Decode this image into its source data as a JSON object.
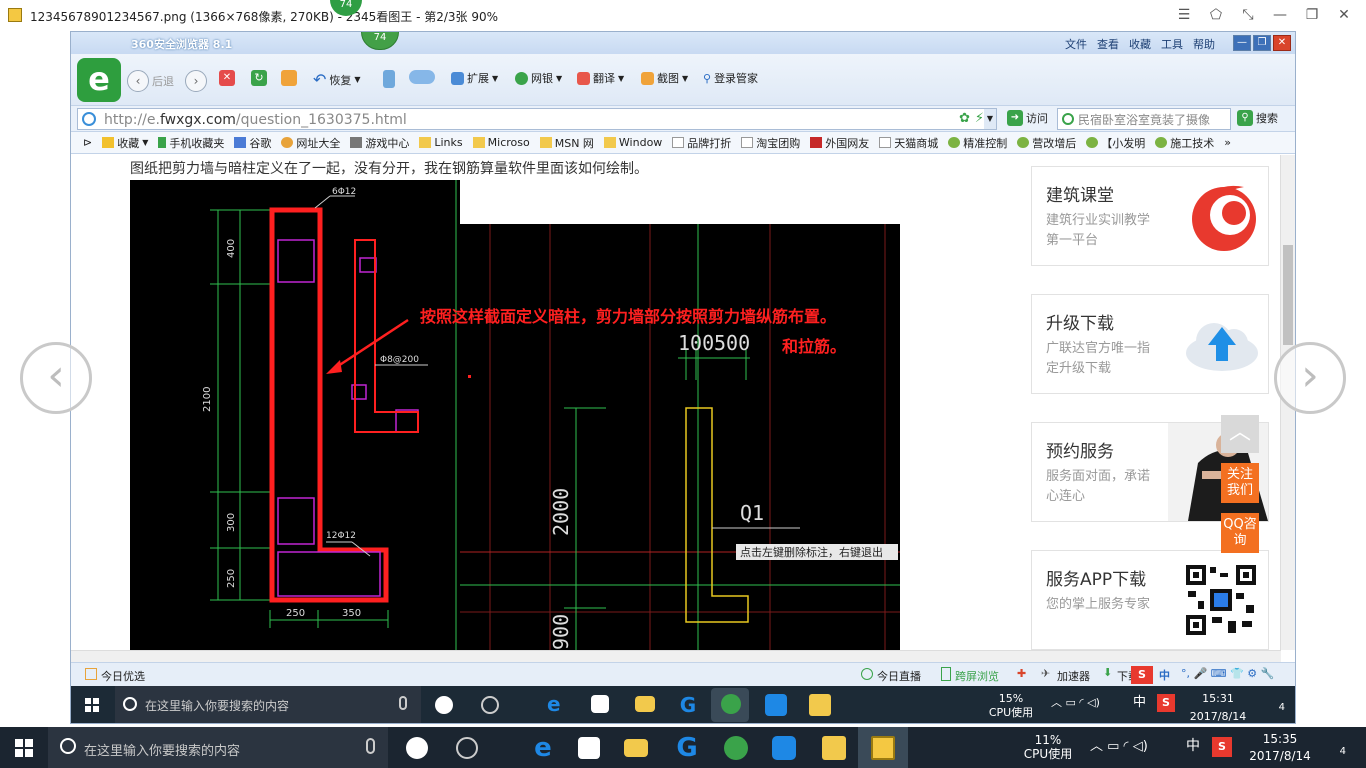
{
  "viewer": {
    "title": "12345678901234567.png (1366×768像素, 270KB) - 2345看图王 - 第2/3张 90%",
    "badge": "74",
    "controls": [
      "☰",
      "⬠",
      "⤡",
      "—",
      "❐",
      "✕"
    ],
    "prev_glyph": "‹",
    "next_glyph": "›"
  },
  "browser": {
    "title": "360安全浏览器 8.1",
    "badge": "74",
    "menu": [
      "文件",
      "查看",
      "收藏",
      "工具",
      "帮助"
    ],
    "toolbar": {
      "back": "后退",
      "restore": "恢复",
      "extend": "扩展",
      "bank": "网银",
      "translate": "翻译",
      "screenshot": "截图",
      "login": "登录管家"
    },
    "address": {
      "url_prefix": "http://e.",
      "url_domain": "fwxgx.com",
      "url_path": "/question_1630375.html",
      "visit": "访问",
      "search_value": "民宿卧室浴室竟装了摄像",
      "search_btn": "搜索"
    },
    "favorites": [
      "收藏",
      "手机收藏夹",
      "谷歌",
      "网址大全",
      "游戏中心",
      "Links",
      "Microso",
      "MSN 网",
      "Window",
      "品牌打折",
      "淘宝团购",
      "外国网友",
      "天猫商城",
      "精准控制",
      "营改增后",
      "【小发明",
      "施工技术"
    ],
    "status": {
      "left": "今日优选",
      "live": "今日直播",
      "cross": "跨屏浏览",
      "accel": "加速器",
      "download": "下载"
    },
    "inner_taskbar": {
      "search_placeholder": "在这里输入你要搜索的内容",
      "cpu_value": "15%",
      "cpu_label": "CPU使用",
      "ime": "中",
      "time": "15:31",
      "date": "2017/8/14",
      "notif": "4"
    }
  },
  "page": {
    "question": "图纸把剪力墙与暗柱定义在了一起，没有分开，我在钢筋算量软件里面该如何绘制。",
    "cad": {
      "rebar_top": "6Φ12",
      "rebar_stirrup": "Φ8@200",
      "rebar_bottom": "12Φ12",
      "dim_400": "400",
      "dim_2100": "2100",
      "dim_300": "300",
      "dim_250v": "250",
      "dim_250h": "250",
      "dim_350h": "350",
      "annotation_1": "按照这样截面定义暗柱，剪力墙部分按照剪力墙纵筋布置。",
      "annotation_2": "和拉筋。",
      "dim_100": "100",
      "dim_500": "500",
      "dim_2000": "2000",
      "dim_900": "900",
      "label_q1": "Q1",
      "hint": "点击左键删除标注，右键退出"
    },
    "sidebar": [
      {
        "title": "建筑课堂",
        "desc": "建筑行业实训教学第一平台",
        "icon": "flame-logo-icon"
      },
      {
        "title": "升级下载",
        "desc": "广联达官方唯一指定升级下载",
        "icon": "cloud-upload-icon"
      },
      {
        "title": "预约服务",
        "desc": "服务面对面，承诺心连心",
        "icon": "businessman-photo"
      },
      {
        "title": "服务APP下载",
        "desc": "您的掌上服务专家",
        "icon": "qr-code-icon"
      }
    ],
    "float_follow": "关注我们",
    "float_qq": "QQ咨询",
    "back_to_top": "︿"
  },
  "os_taskbar": {
    "search_placeholder": "在这里输入你要搜索的内容",
    "cpu_value": "11%",
    "cpu_label": "CPU使用",
    "ime": "中",
    "time": "15:35",
    "date": "2017/8/14",
    "notif": "4"
  }
}
